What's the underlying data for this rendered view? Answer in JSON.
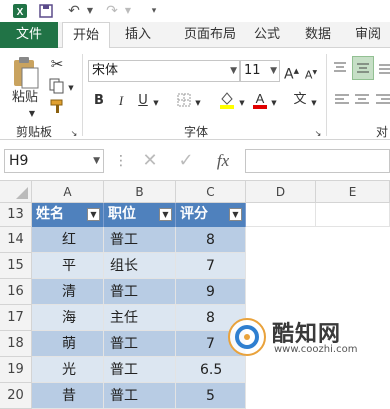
{
  "ribbon": {
    "file_tab": "文件",
    "tabs": [
      "开始",
      "插入",
      "页面布局",
      "公式",
      "数据",
      "审阅"
    ],
    "clipboard": {
      "paste_label": "粘贴",
      "group_label": "剪贴板"
    },
    "font": {
      "family": "宋体",
      "size": "11",
      "group_label": "字体",
      "grow": "A",
      "shrink": "A",
      "bold": "B",
      "italic": "I",
      "underline": "U",
      "phonetic": "文"
    },
    "alignment": {
      "group_label": "对"
    }
  },
  "formula_bar": {
    "name_box": "H9",
    "fx_label": "fx",
    "cancel": "✕",
    "confirm": "✓",
    "value": ""
  },
  "columns": [
    "A",
    "B",
    "C",
    "D",
    "E"
  ],
  "rows": [
    {
      "num": "13",
      "a": "姓名",
      "b": "职位",
      "c": "评分",
      "header": true
    },
    {
      "num": "14",
      "a": "红",
      "b": "普工",
      "c": "8"
    },
    {
      "num": "15",
      "a": "平",
      "b": "组长",
      "c": "7"
    },
    {
      "num": "16",
      "a": "清",
      "b": "普工",
      "c": "9"
    },
    {
      "num": "17",
      "a": "海",
      "b": "主任",
      "c": "8"
    },
    {
      "num": "18",
      "a": "萌",
      "b": "普工",
      "c": "7"
    },
    {
      "num": "19",
      "a": "光",
      "b": "普工",
      "c": "6.5"
    },
    {
      "num": "20",
      "a": "昔",
      "b": "普工",
      "c": "5"
    }
  ],
  "watermark": {
    "brand": "酷知网",
    "url": "www.coozhi.com"
  },
  "colors": {
    "excel_green": "#217346",
    "table_header": "#4f81bd",
    "band_dark": "#b8cce4",
    "band_light": "#dce6f1",
    "font_red": "#e00000",
    "highlight_yellow": "#ffff00"
  }
}
